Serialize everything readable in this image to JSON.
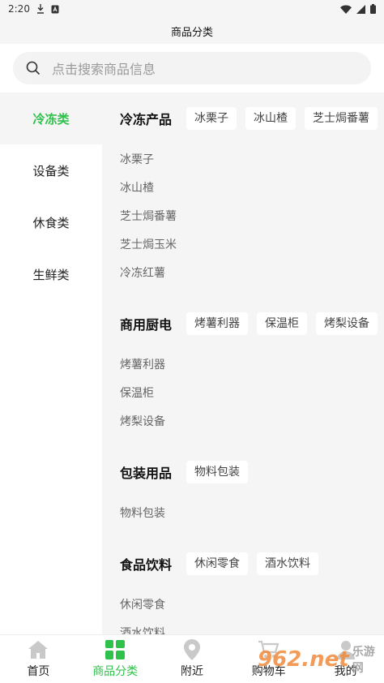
{
  "status_bar": {
    "time": "2:20"
  },
  "header": {
    "title": "商品分类"
  },
  "search": {
    "placeholder": "点击搜索商品信息"
  },
  "categories": [
    {
      "label": "冷冻类",
      "active": true
    },
    {
      "label": "设备类",
      "active": false
    },
    {
      "label": "休食类",
      "active": false
    },
    {
      "label": "生鲜类",
      "active": false
    }
  ],
  "sections": [
    {
      "title": "冷冻产品",
      "chips": [
        "冰栗子",
        "冰山楂",
        "芝士焗番薯"
      ],
      "items": [
        "冰栗子",
        "冰山楂",
        "芝士焗番薯",
        "芝士焗玉米",
        "冷冻红薯"
      ]
    },
    {
      "title": "商用厨电",
      "chips": [
        "烤薯利器",
        "保温柜",
        "烤梨设备"
      ],
      "items": [
        "烤薯利器",
        "保温柜",
        "烤梨设备"
      ]
    },
    {
      "title": "包装用品",
      "chips": [
        "物料包装"
      ],
      "items": [
        "物料包装"
      ]
    },
    {
      "title": "食品饮料",
      "chips": [
        "休闲零食",
        "酒水饮料"
      ],
      "items": [
        "休闲零食",
        "酒水饮料"
      ]
    }
  ],
  "bottom_nav": [
    {
      "label": "首页",
      "icon": "home-icon",
      "active": false
    },
    {
      "label": "商品分类",
      "icon": "category-icon",
      "active": true
    },
    {
      "label": "附近",
      "icon": "location-icon",
      "active": false
    },
    {
      "label": "购物车",
      "icon": "cart-icon",
      "active": false
    },
    {
      "label": "我的",
      "icon": "user-icon",
      "active": false
    }
  ],
  "watermark": {
    "text": "962.net",
    "brand": "乐游网"
  },
  "colors": {
    "accent": "#2ec24a",
    "background": "#f5f5f5",
    "surface": "#ffffff"
  }
}
